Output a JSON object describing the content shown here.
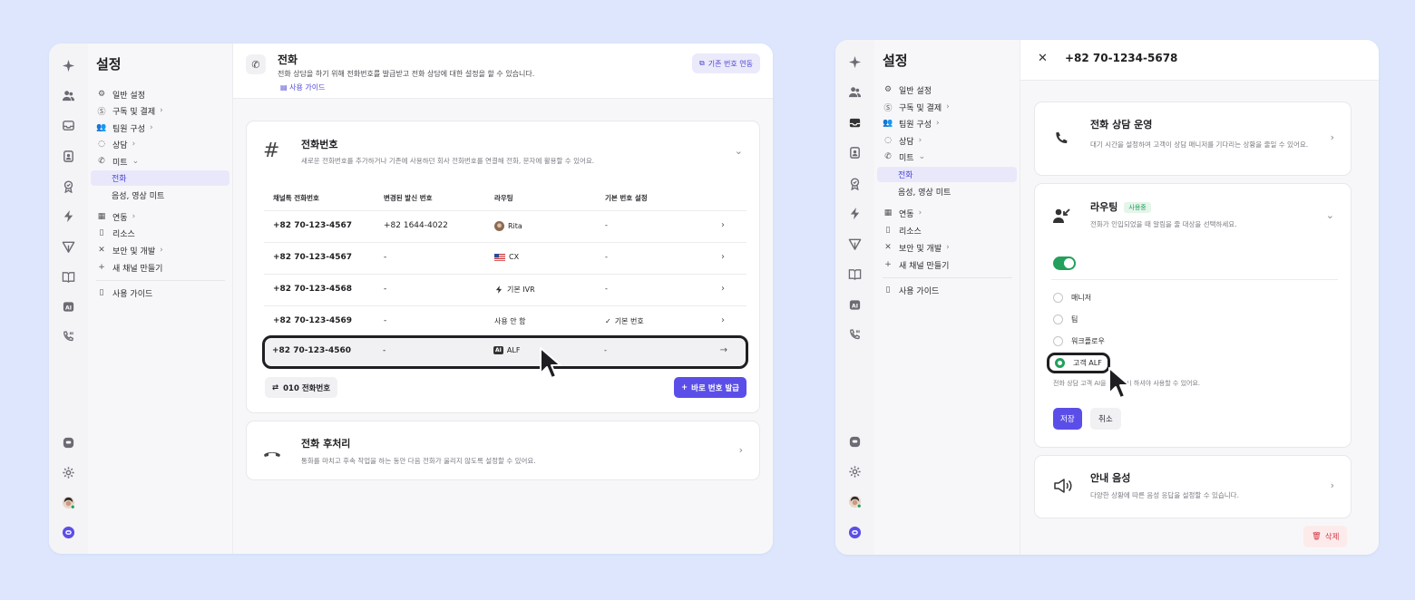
{
  "nav": {
    "settings_title": "설정",
    "items": [
      {
        "label": "일반 설정",
        "icon": "gear-icon"
      },
      {
        "label": "구독 및 결제",
        "icon": "dollar-icon",
        "chevron": "›"
      },
      {
        "label": "팀원 구성",
        "icon": "team-icon",
        "chevron": "›"
      },
      {
        "label": "상담",
        "icon": "chat-icon",
        "chevron": "›"
      },
      {
        "label": "미트",
        "icon": "phone-icon",
        "chevron": "⌄"
      }
    ],
    "sub_items": [
      "전화",
      "음성, 영상 미트"
    ],
    "items_lower": [
      {
        "label": "연동",
        "icon": "grid-icon",
        "chevron": "›"
      },
      {
        "label": "리소스",
        "icon": "book-icon"
      },
      {
        "label": "보안 및 개발",
        "icon": "tools-icon",
        "chevron": "›"
      },
      {
        "label": "새 채널 만들기",
        "icon": "plus-icon"
      }
    ],
    "guide": "사용 가이드"
  },
  "page1": {
    "header": {
      "title": "전화",
      "description": "전화 상담을 하기 위해 전화번호를 발급받고 전화 상담에 대한 설정을 할 수 있습니다.",
      "guide_link": "사용 가이드",
      "link_button": "기존 번호 연동"
    },
    "numbers_card": {
      "title": "전화번호",
      "description": "새로운 전화번호를 추가하거나 기존에 사용하던 회사 전화번호를 연결해 전화, 문자에 활용할 수 있어요.",
      "columns": [
        "채널톡 전화번호",
        "변경된 발신 번호",
        "라우팅",
        "기본 번호 설정"
      ],
      "rows": [
        {
          "number": "+82 70-123-4567",
          "caller_id": "+82 1644-4022",
          "routing": "Rita",
          "routing_icon": "avatar-icon",
          "default": "-"
        },
        {
          "number": "+82 70-123-4567",
          "caller_id": "-",
          "routing": "CX",
          "routing_icon": "us-flag-icon",
          "default": "-"
        },
        {
          "number": "+82 70-123-4568",
          "caller_id": "-",
          "routing": "기본 IVR",
          "routing_icon": "bolt-icon",
          "default": "-"
        },
        {
          "number": "+82 70-123-4569",
          "caller_id": "-",
          "routing": "사용 안 함",
          "routing_icon": "",
          "default": "기본 번호"
        },
        {
          "number": "+82 70-123-4560",
          "caller_id": "-",
          "routing": "ALF",
          "routing_icon": "ai-badge",
          "default": "-"
        }
      ],
      "ai_badge": "AI",
      "btn_010": "010 전화번호",
      "btn_issue": "바로 번호 발급"
    },
    "after_call_card": {
      "title": "전화 후처리",
      "description": "통화를 마치고 후속 작업을 하는 동안 다음 전화가 울리지 않도록 설정할 수 있어요."
    }
  },
  "page2": {
    "phone_title": "+82 70-1234-5678",
    "operation_card": {
      "title": "전화 상담 운영",
      "description": "대기 시간을 설정하여 고객이 상담 매니저를 기다리는 상황을 줄일 수 있어요."
    },
    "routing_card": {
      "title": "라우팅",
      "badge": "사용중",
      "description": "전화가 인입되었을 때 알림을 줄 대상을 선택하세요.",
      "toggle_on": true,
      "options": [
        "매니저",
        "팀",
        "워크플로우",
        "고객 ALF"
      ],
      "selected": "고객 ALF",
      "note": "전화 상담 고객 AI을 퍼블리시 하셔야 사용할 수 있어요.",
      "save": "저장",
      "cancel": "취소"
    },
    "announcement_card": {
      "title": "안내 음성",
      "description": "다양한 상황에 따른 음성 응답을 설정할 수 있습니다."
    },
    "delete": "삭제"
  },
  "colors": {
    "accent": "#5b4ee8",
    "green": "#23a05b",
    "background": "#dde6fc"
  }
}
